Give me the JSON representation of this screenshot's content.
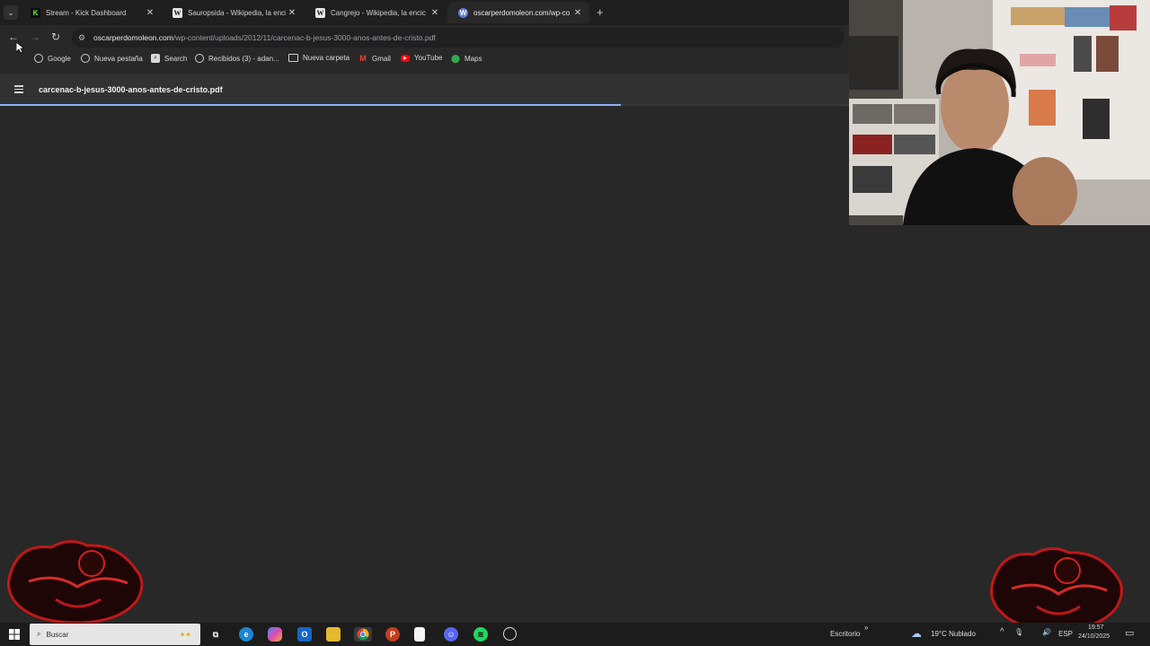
{
  "tabs": [
    {
      "title": "Stream - Kick Dashboard",
      "favicon": "kick-icon"
    },
    {
      "title": "Sauropsida - Wikipedia, la encic",
      "favicon": "wikipedia-icon"
    },
    {
      "title": "Cangrejo - Wikipedia, la encic",
      "favicon": "wikipedia-icon"
    },
    {
      "title": "oscarperdomoleon.com/wp-co",
      "favicon": "wordpress-icon"
    }
  ],
  "address": {
    "host": "oscarperdomoleon.com",
    "path": "/wp-content/uploads/2012/11/carcenac-b-jesus-3000-anos-antes-de-cristo.pdf"
  },
  "bookmarks": [
    {
      "label": "Google",
      "icon": "google-icon"
    },
    {
      "label": "Nueva pestaña",
      "icon": "globe-icon"
    },
    {
      "label": "Search",
      "icon": "search-icon"
    },
    {
      "label": "Recibidos (3) - adan...",
      "icon": "google-icon"
    },
    {
      "label": "Nueva carpeta",
      "icon": "folder-icon"
    },
    {
      "label": "Gmail",
      "icon": "gmail-icon"
    },
    {
      "label": "YouTube",
      "icon": "youtube-icon"
    },
    {
      "label": "Maps",
      "icon": "maps-icon"
    }
  ],
  "pdf": {
    "filename": "carcenac-b-jesus-3000-anos-antes-de-cristo.pdf",
    "load_progress": 0.54
  },
  "taskbar": {
    "search_placeholder": "Buscar",
    "desktop_label": "Escritorio",
    "chevron": "»",
    "weather": "19°C  Nublado",
    "language": "ESP",
    "time": "19:57",
    "date": "24/10/2025"
  },
  "colors": {
    "progress": "#8ab4f8",
    "kick_green": "#53fc18",
    "background": "#282828"
  }
}
